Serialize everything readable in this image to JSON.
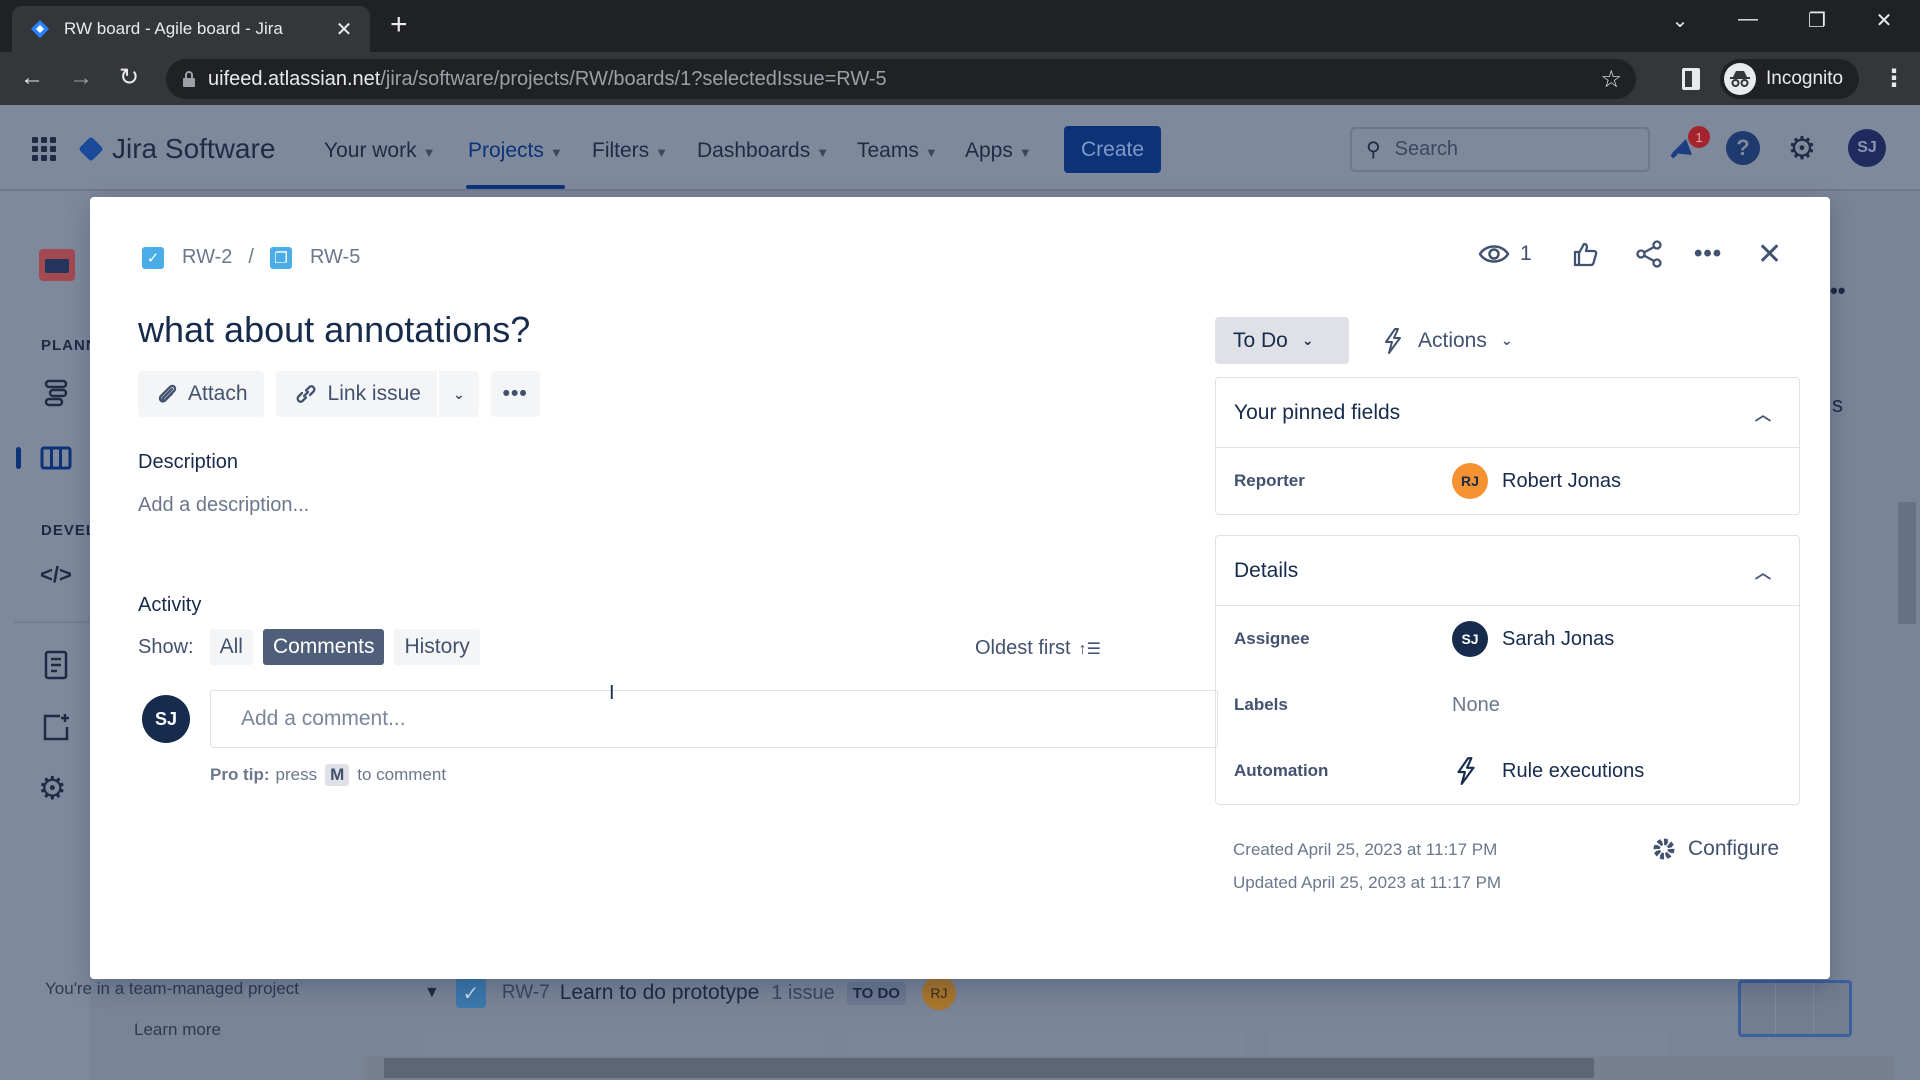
{
  "browser": {
    "tab_title": "RW board - Agile board - Jira",
    "url_host": "uifeed.atlassian.net",
    "url_path": "/jira/software/projects/RW/boards/1?selectedIssue=RW-5",
    "profile_label": "Incognito"
  },
  "jira_nav": {
    "product_name": "Jira Software",
    "items": [
      {
        "label": "Your work"
      },
      {
        "label": "Projects",
        "active": true
      },
      {
        "label": "Filters"
      },
      {
        "label": "Dashboards"
      },
      {
        "label": "Teams"
      },
      {
        "label": "Apps"
      }
    ],
    "create_label": "Create",
    "search_placeholder": "Search",
    "notification_count": "1",
    "user_initials": "SJ"
  },
  "sidebar": {
    "section_planning": "PLANN",
    "section_development": "DEVEL",
    "footer_text": "You're in a team-managed project",
    "learn_more": "Learn more"
  },
  "board": {
    "row": {
      "key": "RW-7",
      "summary": "Learn to do prototype",
      "count": "1 issue",
      "status": "TO DO",
      "assignee_initials": "RJ"
    },
    "bg_fragment": "s"
  },
  "issue": {
    "breadcrumb": [
      {
        "key": "RW-2",
        "type": "task"
      },
      {
        "key": "RW-5",
        "type": "subtask"
      }
    ],
    "breadcrumb_sep": "/",
    "title": "what about annotations?",
    "toolbar": {
      "attach_label": "Attach",
      "link_issue_label": "Link issue"
    },
    "description_label": "Description",
    "description_placeholder": "Add a description...",
    "activity": {
      "label": "Activity",
      "show_label": "Show:",
      "filters": [
        {
          "label": "All",
          "active": false
        },
        {
          "label": "Comments",
          "active": true
        },
        {
          "label": "History",
          "active": false
        }
      ],
      "sort_label": "Oldest first",
      "comment_avatar": "SJ",
      "comment_placeholder": "Add a comment...",
      "protip_bold": "Pro tip:",
      "protip_pre": "press",
      "protip_key": "M",
      "protip_post": "to comment"
    },
    "header": {
      "watch_count": "1"
    },
    "status": "To Do",
    "actions_label": "Actions",
    "pinned": {
      "title": "Your pinned fields",
      "fields": [
        {
          "label": "Reporter",
          "value": "Robert Jonas",
          "initials": "RJ",
          "color": "#f79232"
        }
      ]
    },
    "details": {
      "title": "Details",
      "assignee_label": "Assignee",
      "assignee": "Sarah Jonas",
      "assignee_initials": "SJ",
      "assignee_color": "#172b4d",
      "labels_label": "Labels",
      "labels_value": "None",
      "automation_label": "Automation",
      "automation_value": "Rule executions"
    },
    "created": "Created April 25, 2023 at 11:17 PM",
    "updated": "Updated April 25, 2023 at 11:17 PM",
    "configure_label": "Configure"
  },
  "colors": {
    "brand_blue": "#0052cc",
    "overlay_nav": "#0c3277",
    "status_bg": "#dfe1e6",
    "active_filter": "#505f79"
  }
}
